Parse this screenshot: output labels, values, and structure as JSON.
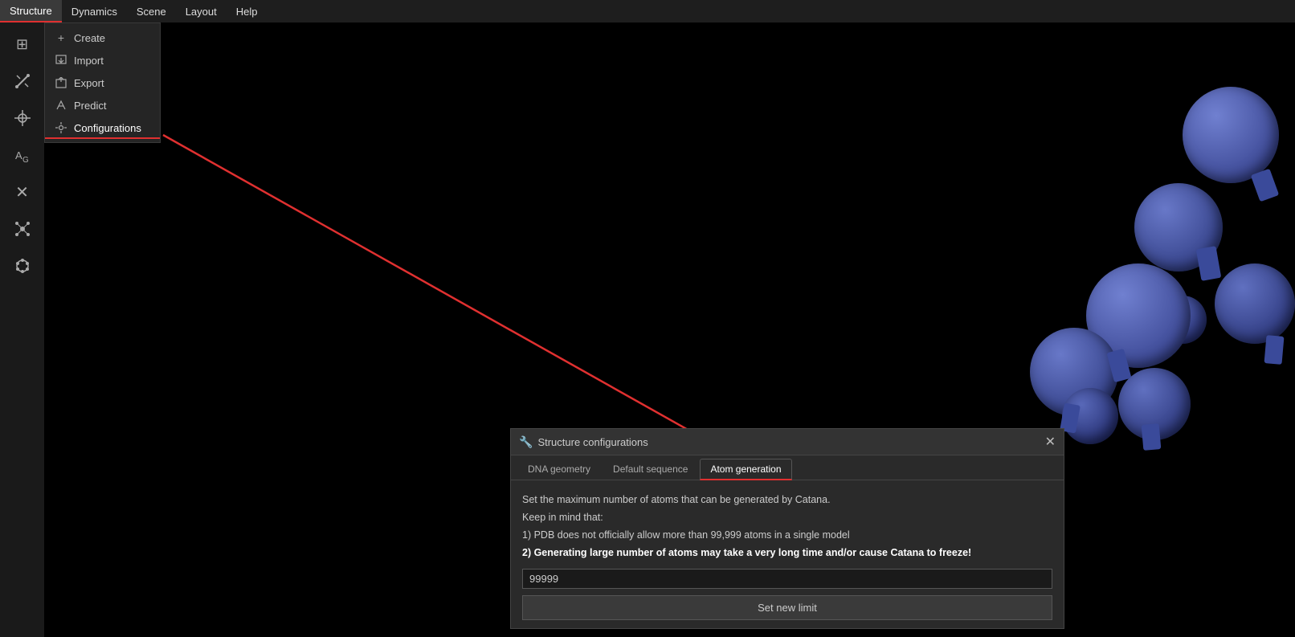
{
  "menubar": {
    "items": [
      {
        "id": "structure",
        "label": "Structure",
        "active": true
      },
      {
        "id": "dynamics",
        "label": "Dynamics"
      },
      {
        "id": "scene",
        "label": "Scene"
      },
      {
        "id": "layout",
        "label": "Layout"
      },
      {
        "id": "help",
        "label": "Help"
      }
    ]
  },
  "submenu": {
    "items": [
      {
        "id": "create",
        "label": "Create",
        "icon": "+"
      },
      {
        "id": "import",
        "label": "Import",
        "icon": "⬆"
      },
      {
        "id": "export",
        "label": "Export",
        "icon": "⬇"
      },
      {
        "id": "predict",
        "label": "Predict",
        "icon": "✦"
      },
      {
        "id": "configurations",
        "label": "Configurations",
        "icon": "🔧"
      }
    ]
  },
  "sidebar": {
    "icons": [
      {
        "id": "grid",
        "symbol": "⊞"
      },
      {
        "id": "dna",
        "symbol": "⤢"
      },
      {
        "id": "atom-add",
        "symbol": "⊕"
      },
      {
        "id": "transform",
        "symbol": "↔"
      },
      {
        "id": "close",
        "symbol": "✕"
      },
      {
        "id": "cluster",
        "symbol": "❋"
      },
      {
        "id": "ring",
        "symbol": "✿"
      }
    ]
  },
  "config_panel": {
    "title": "Structure configurations",
    "close_label": "✕",
    "tabs": [
      {
        "id": "dna-geometry",
        "label": "DNA geometry",
        "active": false
      },
      {
        "id": "default-sequence",
        "label": "Default sequence",
        "active": false
      },
      {
        "id": "atom-generation",
        "label": "Atom generation",
        "active": true
      }
    ],
    "atom_generation": {
      "line1": "Set the maximum number of atoms that can be generated by Catana.",
      "line2": "Keep in mind that:",
      "line3": "1) PDB does not officially allow more than 99,999 atoms in a single model",
      "line4": "2) Generating large number of atoms may take a very long time and/or cause Catana to freeze!",
      "input_value": "99999",
      "button_label": "Set new limit"
    }
  }
}
